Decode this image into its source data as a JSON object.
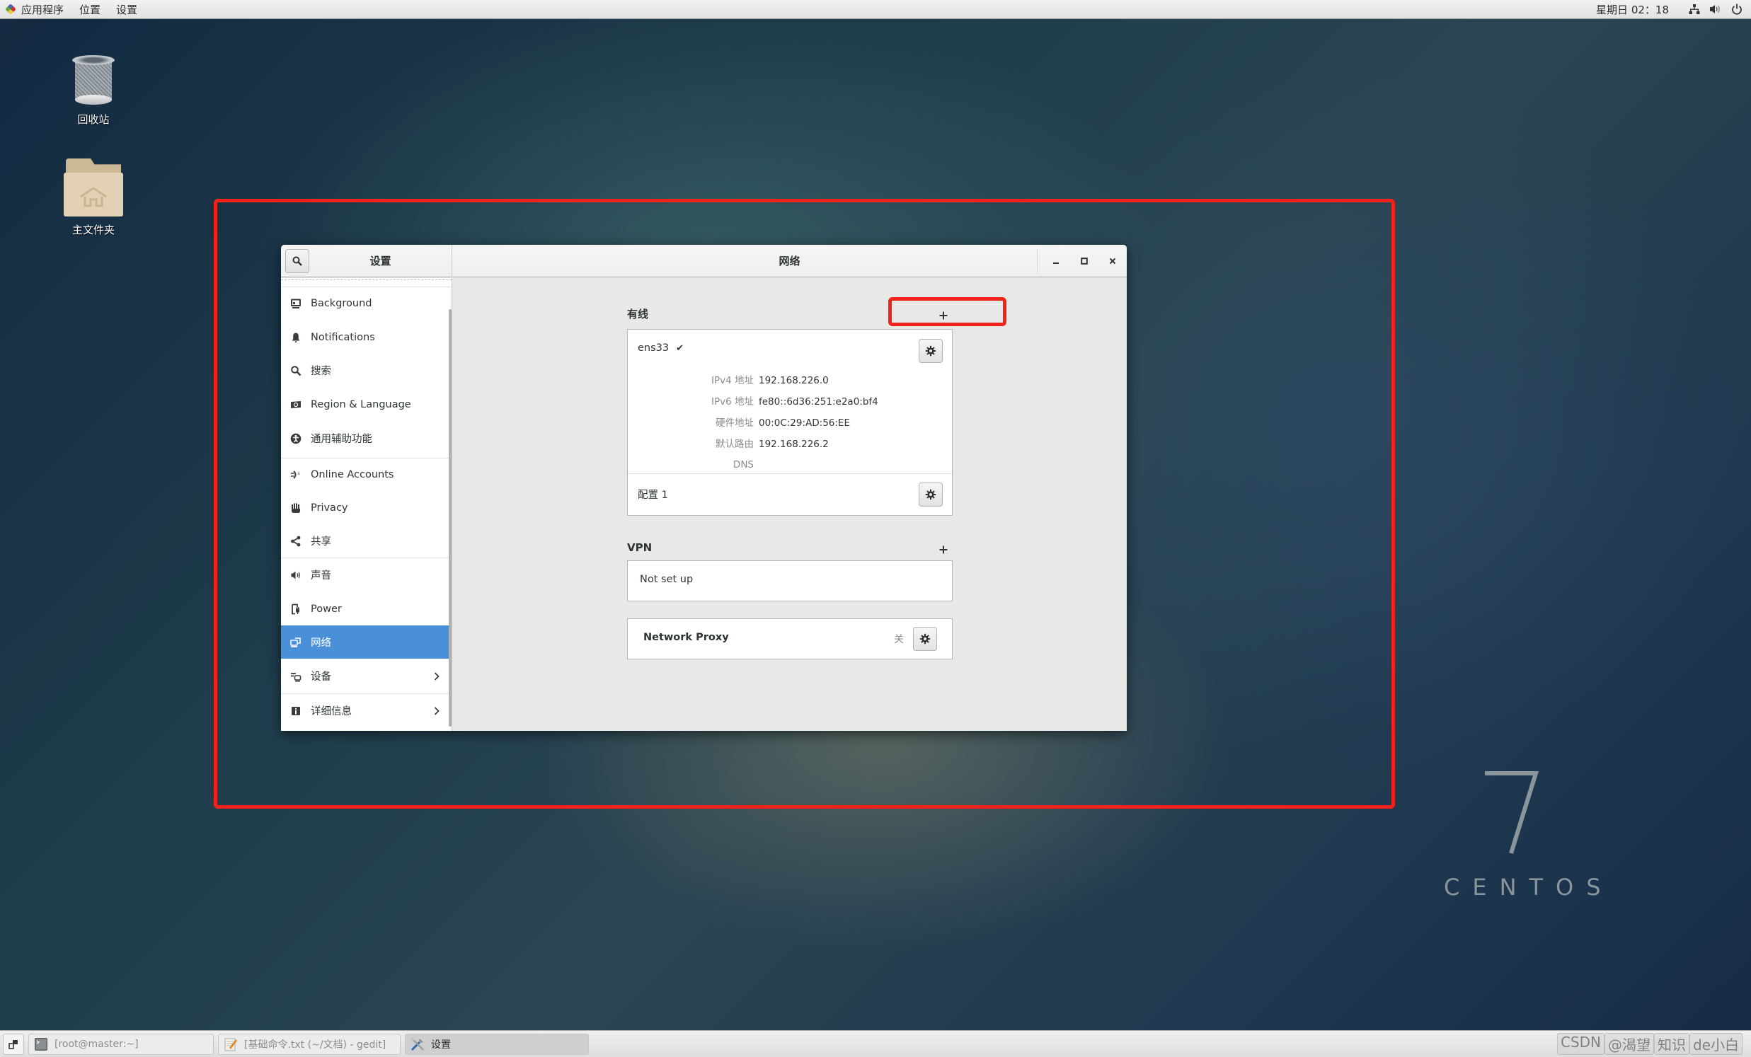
{
  "top_panel": {
    "menus": [
      "应用程序",
      "位置",
      "设置"
    ],
    "clock": "星期日 02：18",
    "tray_icons": [
      "network-icon",
      "volume-icon",
      "power-icon"
    ]
  },
  "desktop": {
    "icons": [
      {
        "label": "回收站",
        "icon": "trash-icon"
      },
      {
        "label": "主文件夹",
        "icon": "home-folder-icon"
      }
    ],
    "logo": {
      "number": "7",
      "word": "CENTOS"
    }
  },
  "annotations": {
    "color": "#f0231a",
    "highlights": [
      "settings-window",
      "wired-add-button"
    ]
  },
  "window": {
    "sidebar_title": "设置",
    "panel_title": "网络",
    "controls": [
      "minimize",
      "maximize",
      "close"
    ],
    "sidebar": {
      "items": [
        {
          "label": "Background",
          "icon": "background-icon"
        },
        {
          "label": "Notifications",
          "icon": "bell-icon"
        },
        {
          "label": "搜索",
          "icon": "search-icon"
        },
        {
          "label": "Region & Language",
          "icon": "region-icon"
        },
        {
          "label": "通用辅助功能",
          "icon": "accessibility-icon"
        },
        {
          "label": "Online Accounts",
          "icon": "online-accounts-icon"
        },
        {
          "label": "Privacy",
          "icon": "hand-icon"
        },
        {
          "label": "共享",
          "icon": "share-icon"
        },
        {
          "label": "声音",
          "icon": "speaker-icon"
        },
        {
          "label": "Power",
          "icon": "power-plug-icon"
        },
        {
          "label": "网络",
          "icon": "network-icon",
          "active": true
        },
        {
          "label": "设备",
          "icon": "devices-icon",
          "has_submenu": true
        },
        {
          "label": "详细信息",
          "icon": "info-icon",
          "has_submenu": true
        }
      ],
      "accent": "#4a90d9"
    },
    "wired": {
      "title": "有线",
      "add_label": "+",
      "interface": {
        "name": "ens33",
        "connected": "✔",
        "details": [
          {
            "key": "IPv4 地址",
            "value": "192.168.226.0"
          },
          {
            "key": "IPv6 地址",
            "value": "fe80::6d36:251:e2a0:bf4"
          },
          {
            "key": "硬件地址",
            "value": "00:0C:29:AD:56:EE"
          },
          {
            "key": "默认路由",
            "value": "192.168.226.2"
          },
          {
            "key": "DNS",
            "value": ""
          }
        ]
      },
      "profile": "配置 1"
    },
    "vpn": {
      "title": "VPN",
      "add_label": "+",
      "status": "Not set up"
    },
    "proxy": {
      "label": "Network Proxy",
      "state": "关"
    }
  },
  "taskbar": {
    "tasks": [
      {
        "label": "[root@master:~]",
        "icon": "terminal-icon",
        "active": false
      },
      {
        "label": "[基础命令.txt (~/文档) - gedit]",
        "icon": "text-editor-icon",
        "active": false
      },
      {
        "label": "设置",
        "icon": "settings-tools-icon",
        "active": true
      }
    ],
    "watermark": [
      "CSDN",
      "@渴望",
      "知识",
      "de小白"
    ]
  }
}
